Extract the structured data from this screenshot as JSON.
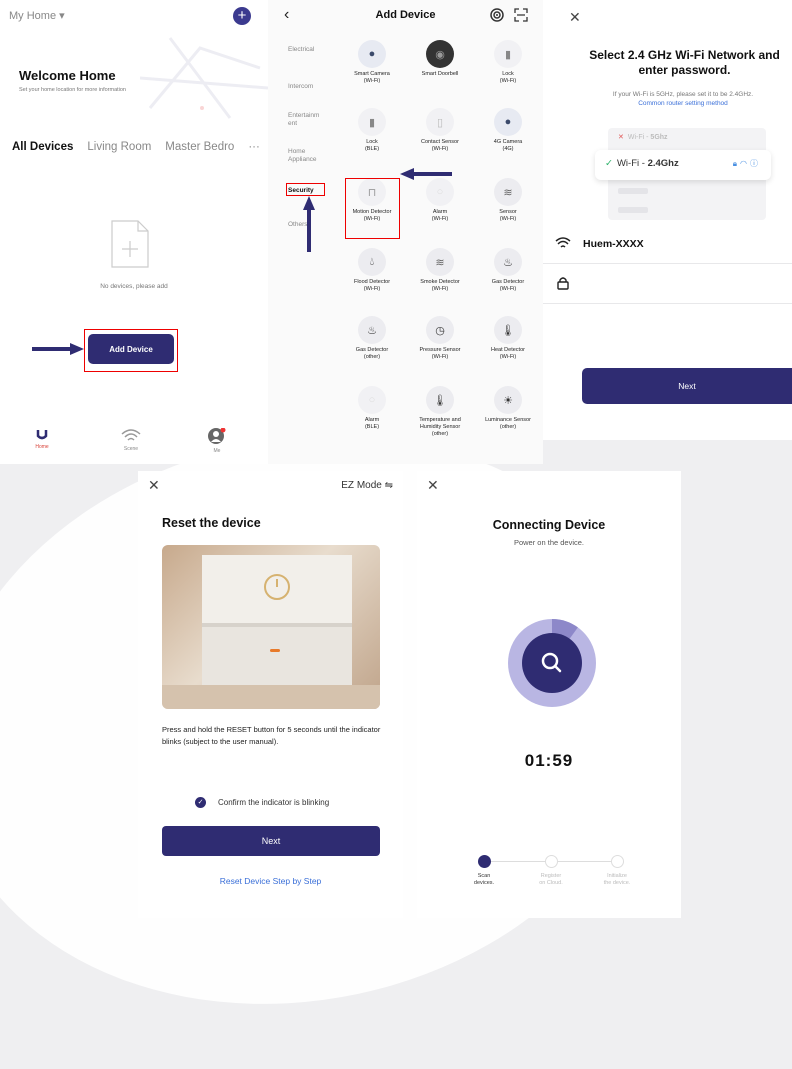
{
  "home": {
    "home_selector": "My Home ▾",
    "welcome_title": "Welcome Home",
    "welcome_subtitle": "Set your home location for more information",
    "tabs": [
      "All Devices",
      "Living Room",
      "Master Bedro"
    ],
    "more": "···",
    "empty_text": "No devices, please add",
    "add_device_button": "Add Device",
    "nav": [
      {
        "label": "Home",
        "icon": "home-icon"
      },
      {
        "label": "Scene",
        "icon": "wifi-icon"
      },
      {
        "label": "Me",
        "icon": "user-icon"
      }
    ]
  },
  "add_device": {
    "title": "Add Device",
    "categories": [
      "Electrical",
      "Intercom",
      "Entertainm\nent",
      "Home\nAppliance",
      "Security",
      "Others"
    ],
    "selected_category": "Security",
    "devices": [
      {
        "name": "Smart Camera\n(Wi-Fi)",
        "icon": "camera-icon"
      },
      {
        "name": "Smart Doorbell",
        "icon": "doorbell-icon"
      },
      {
        "name": "Lock\n(Wi-Fi)",
        "icon": "lock-icon"
      },
      {
        "name": "Lock\n(BLE)",
        "icon": "lock-icon"
      },
      {
        "name": "Contact Sensor\n(Wi-Fi)",
        "icon": "contact-sensor-icon"
      },
      {
        "name": "4G Camera\n(4G)",
        "icon": "camera-icon"
      },
      {
        "name": "Motion Detector\n(Wi-Fi)",
        "icon": "motion-detector-icon"
      },
      {
        "name": "Alarm\n(Wi-Fi)",
        "icon": "alarm-icon"
      },
      {
        "name": "Sensor\n(Wi-Fi)",
        "icon": "sensor-icon"
      },
      {
        "name": "Flood Detector\n(Wi-Fi)",
        "icon": "flood-icon"
      },
      {
        "name": "Smoke Detector\n(Wi-Fi)",
        "icon": "smoke-icon"
      },
      {
        "name": "Gas Detector\n(Wi-Fi)",
        "icon": "flame-icon"
      },
      {
        "name": "Gas Detector\n(other)",
        "icon": "flame-icon"
      },
      {
        "name": "Pressure Sensor\n(Wi-Fi)",
        "icon": "gauge-icon"
      },
      {
        "name": "Heat Detector\n(Wi-Fi)",
        "icon": "thermometer-icon"
      },
      {
        "name": "Alarm\n(BLE)",
        "icon": "alarm-icon"
      },
      {
        "name": "Temperature and\nHumidity Sensor\n(other)",
        "icon": "thermometer-icon"
      },
      {
        "name": "Luminance Sensor\n(other)",
        "icon": "sun-icon"
      }
    ]
  },
  "wifi": {
    "title": "Select 2.4 GHz Wi-Fi Network and enter password.",
    "subtitle": "If your Wi-Fi is 5GHz, please set it to be 2.4GHz.",
    "link": "Common router setting method",
    "bad_network_prefix": "Wi-Fi - ",
    "bad_network_band": "5Ghz",
    "good_network_prefix": "Wi-Fi - ",
    "good_network_band": "2.4Ghz",
    "ssid": "Huem-XXXX",
    "next": "Next"
  },
  "reset": {
    "mode": "EZ Mode ⇋",
    "title": "Reset the device",
    "description": "Press and hold the RESET button for 5 seconds until the indicator blinks (subject to the user manual).",
    "confirm": "Confirm the indicator is blinking",
    "next": "Next",
    "link": "Reset Device Step by Step"
  },
  "connecting": {
    "title": "Connecting Device",
    "subtitle": "Power on the device.",
    "timer": "01:59",
    "progress_fraction": 0.1,
    "steps": [
      {
        "label": "Scan\ndevices.",
        "state": "active"
      },
      {
        "label": "Register\non Cloud.",
        "state": "pending"
      },
      {
        "label": "Initialize\nthe device.",
        "state": "pending"
      }
    ]
  },
  "colors": {
    "primary": "#2f2c72",
    "highlight_box": "#ee0000",
    "link": "#3a6fd8",
    "active_nav": "#d9443b",
    "progress_ring": "#b9b6e3"
  }
}
